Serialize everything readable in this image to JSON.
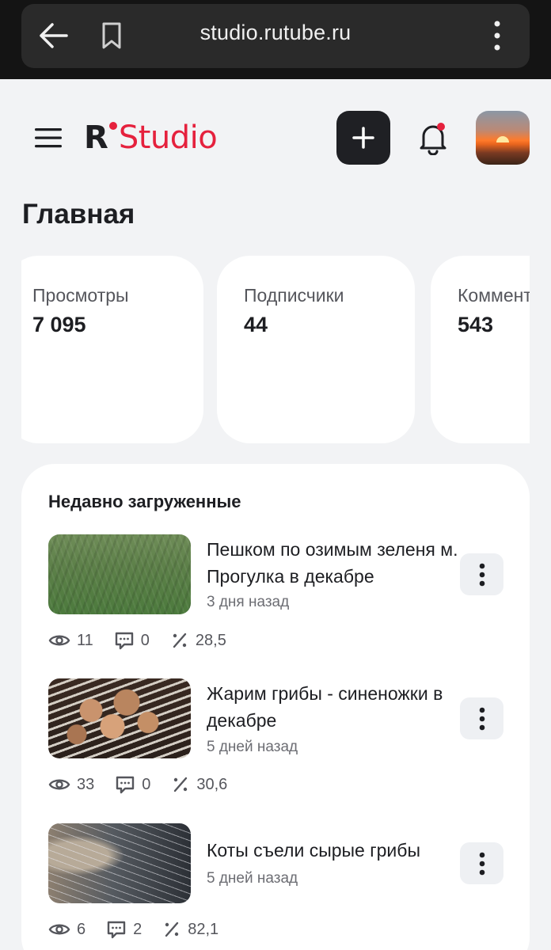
{
  "browser": {
    "url": "studio.rutube.ru"
  },
  "header": {
    "logo_letter": "R",
    "logo_word": "Studio",
    "accent_color": "#e5213d"
  },
  "page": {
    "title": "Главная"
  },
  "stats": [
    {
      "label": "Просмотры",
      "value": "7 095"
    },
    {
      "label": "Подписчики",
      "value": "44"
    },
    {
      "label": "Комментарии",
      "value": "543"
    }
  ],
  "recent": {
    "title": "Недавно загруженные",
    "videos": [
      {
        "title": "Пешком по озимым зеленя м. Прогулка в декабре",
        "date": "3 дня назад",
        "views": "11",
        "comments": "0",
        "ratio": "28,5",
        "thumbnail": "green-field"
      },
      {
        "title": "Жарим грибы - синеножки в декабре",
        "date": "5 дней назад",
        "views": "33",
        "comments": "0",
        "ratio": "30,6",
        "thumbnail": "frying-mushrooms"
      },
      {
        "title": "Коты съели сырые грибы",
        "date": "5 дней назад",
        "views": "6",
        "comments": "2",
        "ratio": "82,1",
        "thumbnail": "cat-closeup"
      }
    ]
  }
}
